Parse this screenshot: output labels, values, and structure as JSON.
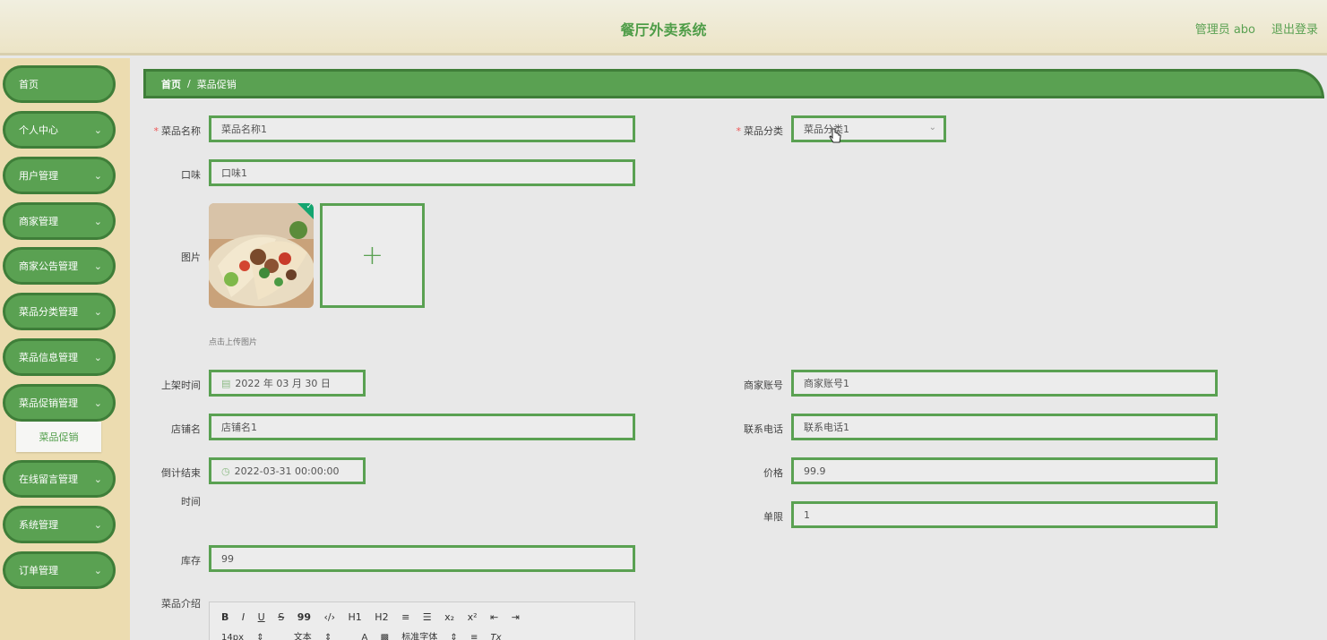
{
  "header": {
    "title": "餐厅外卖系统",
    "user_label": "管理员 abo",
    "logout_label": "退出登录"
  },
  "sidebar": {
    "items": [
      {
        "label": "首页",
        "has_children": false
      },
      {
        "label": "个人中心",
        "has_children": true
      },
      {
        "label": "用户管理",
        "has_children": true
      },
      {
        "label": "商家管理",
        "has_children": true
      },
      {
        "label": "商家公告管理",
        "has_children": true
      },
      {
        "label": "菜品分类管理",
        "has_children": true
      },
      {
        "label": "菜品信息管理",
        "has_children": true
      },
      {
        "label": "菜品促销管理",
        "has_children": true
      },
      {
        "label": "在线留言管理",
        "has_children": true
      },
      {
        "label": "系统管理",
        "has_children": true
      },
      {
        "label": "订单管理",
        "has_children": true
      }
    ],
    "submenu": {
      "label": "菜品促销"
    },
    "chevron": "⌄"
  },
  "breadcrumb": {
    "home": "首页",
    "separator": "/",
    "current": "菜品促销"
  },
  "form": {
    "dish_name": {
      "label": "菜品名称",
      "required": "*",
      "value": "菜品名称1"
    },
    "dish_category": {
      "label": "菜品分类",
      "required": "*",
      "value": "菜品分类1"
    },
    "flavor": {
      "label": "口味",
      "value": "口味1"
    },
    "image": {
      "label": "图片",
      "add_symbol": "+",
      "hint": "点击上传图片"
    },
    "listing_time": {
      "label": "上架时间",
      "value": "2022 年 03 月 30 日"
    },
    "merchant_account": {
      "label": "商家账号",
      "value": "商家账号1"
    },
    "store_name": {
      "label": "店铺名",
      "value": "店铺名1"
    },
    "contact_phone": {
      "label": "联系电话",
      "value": "联系电话1"
    },
    "countdown_end": {
      "label_line1": "倒计结束",
      "label_line2": "时间",
      "value": "2022-03-31 00:00:00"
    },
    "price": {
      "label": "价格",
      "value": "99.9"
    },
    "limit": {
      "label": "单限",
      "value": "1"
    },
    "stock": {
      "label": "库存",
      "value": "99"
    },
    "intro": {
      "label": "菜品介绍"
    }
  },
  "editor_toolbar": {
    "row1": [
      "B",
      "I",
      "U",
      "S",
      "99",
      "‹/›",
      "H1",
      "H2",
      "≡",
      "☰",
      "x₂",
      "x²",
      "⇤",
      "⇥"
    ],
    "row2": [
      "14px",
      "⇕",
      "文本",
      "⇕",
      "A",
      "▩",
      "标准字体",
      "⇕",
      "≡",
      "Tx"
    ]
  },
  "colors": {
    "accent": "#5aa152",
    "accent_dark": "#3f7e39",
    "sidebar_bg": "#ecdcb0",
    "required": "#e55555"
  }
}
